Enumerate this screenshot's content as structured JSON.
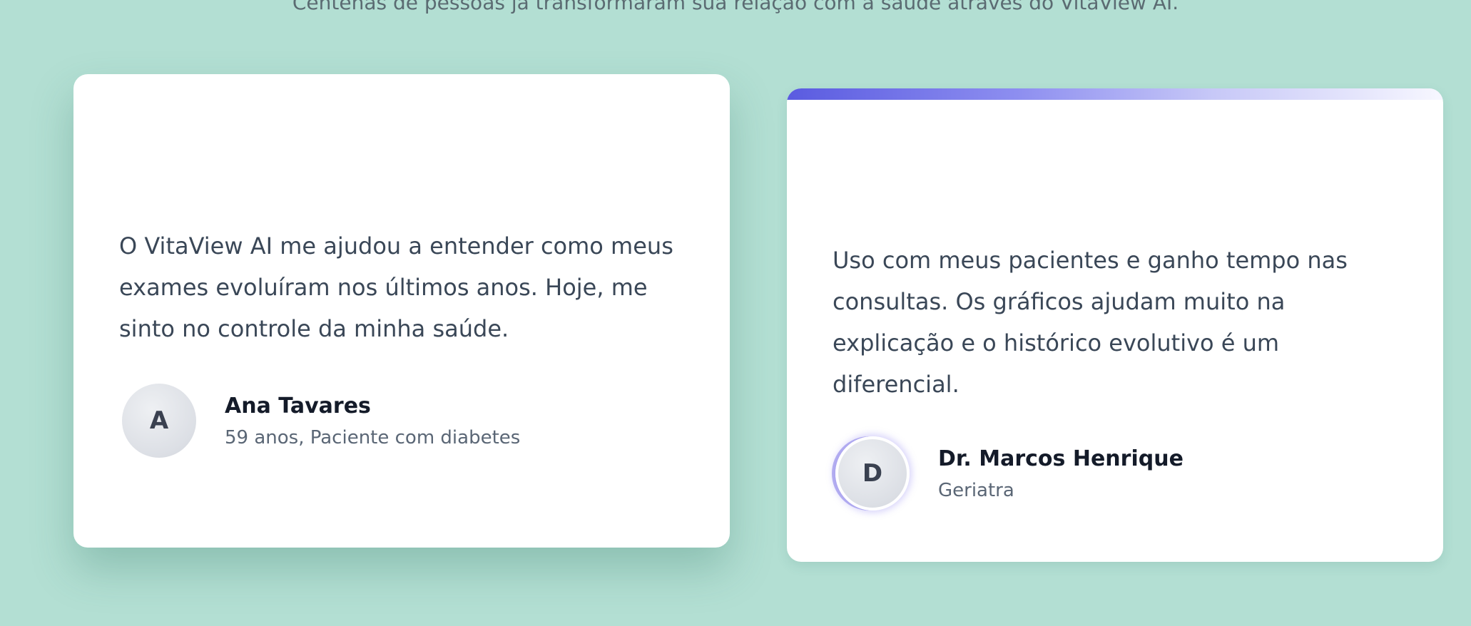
{
  "section": {
    "subtitle": "Centenas de pessoas já transformaram sua relação com a saúde através do VitaView AI."
  },
  "testimonials": [
    {
      "quote": "O VitaView AI me ajudou a entender como meus exames evoluíram nos últimos anos. Hoje, me sinto no controle da minha saúde.",
      "author": "Ana Tavares",
      "role": "59 anos, Paciente com diabetes",
      "initial": "A"
    },
    {
      "quote": "Uso com meus pacientes e ganho tempo nas consultas. Os gráficos ajudam muito na explicação e o histórico evolutivo é um diferencial.",
      "author": "Dr. Marcos Henrique",
      "role": "Geriatra",
      "initial": "D"
    }
  ],
  "colors": {
    "background": "#b3dfd3",
    "accent_start": "#5a5be0",
    "accent_end": "#f7f7ff",
    "text_primary": "#141b29",
    "text_body": "#3a4757"
  }
}
